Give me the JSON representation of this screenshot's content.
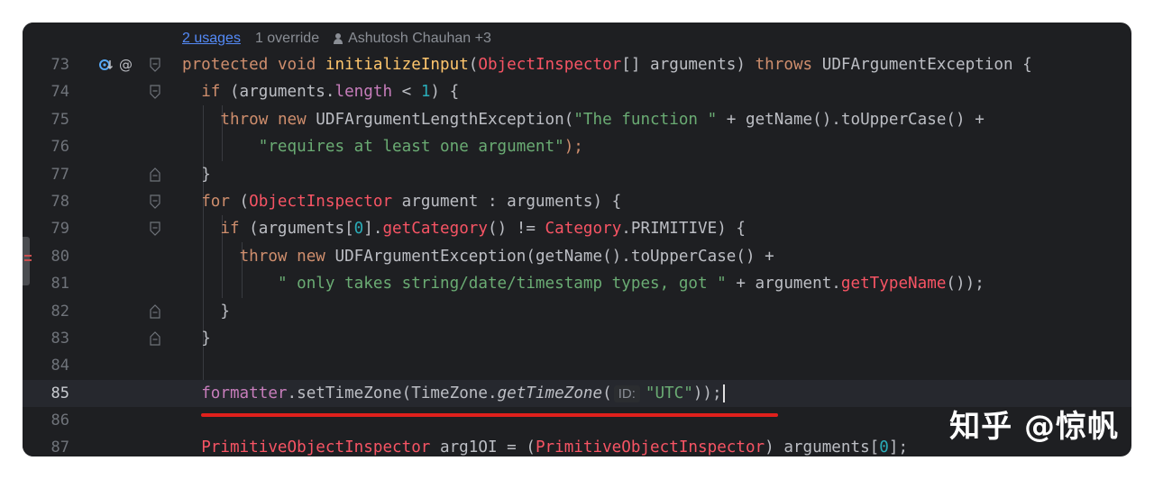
{
  "hints": {
    "usages": "2 usages",
    "override": "1 override",
    "author": "Ashutosh Chauhan +3"
  },
  "lines": [
    {
      "number": "73"
    },
    {
      "number": "74"
    },
    {
      "number": "75"
    },
    {
      "number": "76"
    },
    {
      "number": "77"
    },
    {
      "number": "78"
    },
    {
      "number": "79"
    },
    {
      "number": "80"
    },
    {
      "number": "81"
    },
    {
      "number": "82"
    },
    {
      "number": "83"
    },
    {
      "number": "84"
    },
    {
      "number": "85"
    },
    {
      "number": "86"
    },
    {
      "number": "87"
    }
  ],
  "code": {
    "l73": {
      "k1": "protected",
      "k2": "void",
      "name": "initializeInput",
      "p1": "(",
      "type": "ObjectInspector",
      "p2": "[] arguments) ",
      "k3": "throws",
      "p3": " UDFArgumentException {"
    },
    "l74": {
      "k1": "if",
      "p1": " (arguments.",
      "f1": "length",
      "p2": " < ",
      "n1": "1",
      "p3": ") {"
    },
    "l75": {
      "k1": "throw",
      "k2": "new",
      "p1": " UDFArgumentLengthException(",
      "s1": "\"The function \"",
      "p2": " + getName().toUpperCase() +"
    },
    "l76": {
      "s1": "\"requires at least one argument\"",
      "p1": ");"
    },
    "l77": {
      "p1": "}"
    },
    "l78": {
      "k1": "for",
      "p1": " (",
      "type": "ObjectInspector",
      "p2": " argument : arguments) {"
    },
    "l79": {
      "k1": "if",
      "p1": " (arguments[",
      "n1": "0",
      "p2": "].",
      "m1": "getCategory",
      "p3": "() != ",
      "type": "Category",
      "p4": ".PRIMITIVE) {"
    },
    "l80": {
      "k1": "throw",
      "k2": "new",
      "p1": " UDFArgumentException(getName().toUpperCase() +"
    },
    "l81": {
      "s1": "\" only takes string/date/timestamp types, got \"",
      "p1": " + argument.",
      "m1": "getTypeName",
      "p2": "());"
    },
    "l82": {
      "p1": "}"
    },
    "l83": {
      "p1": "}"
    },
    "l85": {
      "f1": "formatter",
      "p1": ".setTimeZone(TimeZone.",
      "m1": "getTimeZone",
      "p2": "(",
      "hint": "ID:",
      "s1": "\"UTC\"",
      "p3": "));"
    },
    "l87": {
      "type": "PrimitiveObjectInspector",
      "p1": " arg1OI = (",
      "type2": "PrimitiveObjectInspector",
      "p2": ") arguments[",
      "n1": "0",
      "p3": "];"
    }
  },
  "watermark": "知乎 @惊帆",
  "colors": {
    "background": "#1e1f22",
    "keyword": "#cf8e6d",
    "string": "#6aab73",
    "number": "#2aacb8",
    "field": "#c77dbb",
    "method_decl": "#56a8f5",
    "error_type": "#f75464",
    "underline": "#e0201c"
  }
}
